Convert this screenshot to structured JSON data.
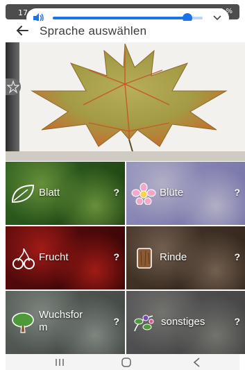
{
  "status_bar": {
    "time": "17:   ",
    "right_text": "      0 %"
  },
  "volume": {
    "level": 0.9,
    "accent": "#1a73e8",
    "track_color": "#bcd3f5"
  },
  "header": {
    "title": "Sprache auswählen"
  },
  "categories": [
    {
      "label": "Blatt",
      "help": "?",
      "icon": "leaf-icon",
      "colors": [
        "#3f7d2a",
        "#7fb048",
        "#1f4a14"
      ]
    },
    {
      "label": "Blüte",
      "help": "?",
      "icon": "flower-icon",
      "colors": [
        "#b6b4e6",
        "#d8d6f2",
        "#8a86c9"
      ]
    },
    {
      "label": "Frucht",
      "help": "?",
      "icon": "cherry-icon",
      "colors": [
        "#7a0f12",
        "#c4221c",
        "#3a0506"
      ]
    },
    {
      "label": "Rinde",
      "help": "?",
      "icon": "bark-icon",
      "colors": [
        "#5a4636",
        "#8b7461",
        "#3a2b20"
      ]
    },
    {
      "label": "Wuchsform",
      "help": "?",
      "icon": "tree-icon",
      "colors": [
        "#6e7770",
        "#9aa39c",
        "#4b524c"
      ]
    },
    {
      "label": "sonstiges",
      "help": "?",
      "icon": "misc-plant-icon",
      "colors": [
        "#6a6a6f",
        "#8b8d86",
        "#4e4f4c"
      ]
    }
  ],
  "nav": {
    "recents": "recents-icon",
    "home": "home-icon",
    "back": "back-icon"
  }
}
